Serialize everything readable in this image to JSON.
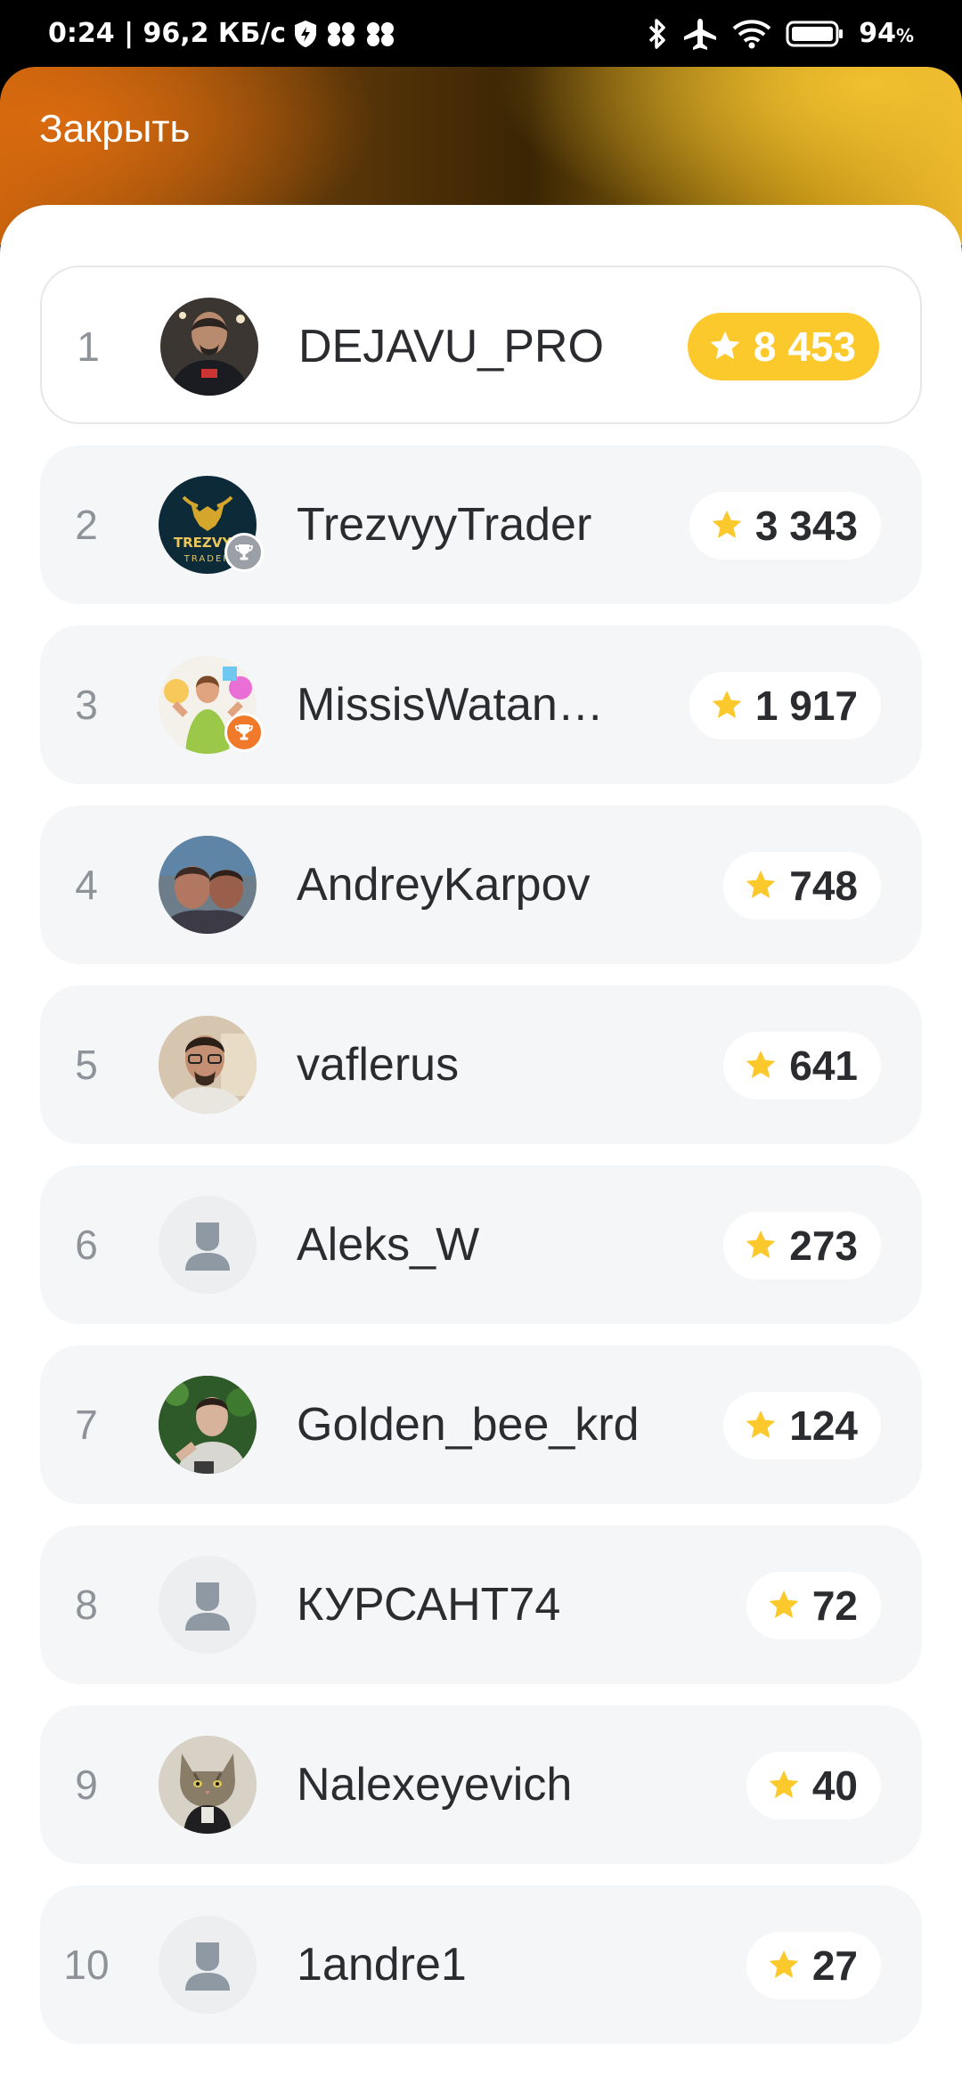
{
  "status_bar": {
    "time_speed": "0:24 | 96,2 КБ/с",
    "battery": "94",
    "battery_unit": "%"
  },
  "header": {
    "close_label": "Закрыть",
    "colors": {
      "orange": "#d96a0f",
      "gold": "#f0c030"
    }
  },
  "leaderboard": [
    {
      "rank": "1",
      "name": "DEJAVU_PRO",
      "score": "8 453",
      "avatar": "photo-man-dark",
      "badge": "",
      "highlight": true
    },
    {
      "rank": "2",
      "name": "TrezvyyTrader",
      "score": "3 343",
      "avatar": "logo-bull-trezvyy",
      "logo_text": "TREZVYY TRADER",
      "badge": "silver-trophy",
      "highlight": false
    },
    {
      "rank": "3",
      "name": "MissisWatan…",
      "score": "1 917",
      "avatar": "photo-woman-colorful",
      "badge": "bronze-trophy",
      "highlight": false
    },
    {
      "rank": "4",
      "name": "AndreyKarpov",
      "score": "748",
      "avatar": "photo-two-people",
      "badge": "",
      "highlight": false
    },
    {
      "rank": "5",
      "name": "vaflerus",
      "score": "641",
      "avatar": "photo-man-glasses",
      "badge": "",
      "highlight": false
    },
    {
      "rank": "6",
      "name": "Aleks_W",
      "score": "273",
      "avatar": "placeholder-user",
      "badge": "",
      "highlight": false
    },
    {
      "rank": "7",
      "name": "Golden_bee_krd",
      "score": "124",
      "avatar": "photo-man-green",
      "badge": "",
      "highlight": false
    },
    {
      "rank": "8",
      "name": "КУРСАНТ74",
      "score": "72",
      "avatar": "placeholder-user",
      "badge": "",
      "highlight": false
    },
    {
      "rank": "9",
      "name": "Nalexeyevich",
      "score": "40",
      "avatar": "photo-cat",
      "badge": "",
      "highlight": false
    },
    {
      "rank": "10",
      "name": "1andre1",
      "score": "27",
      "avatar": "placeholder-user",
      "badge": "",
      "highlight": false
    }
  ],
  "colors": {
    "star": "#fcc92d",
    "gold_pill": "#fcc92d",
    "silver_trophy": "#9aa0a6",
    "bronze_trophy": "#f07a2a"
  }
}
